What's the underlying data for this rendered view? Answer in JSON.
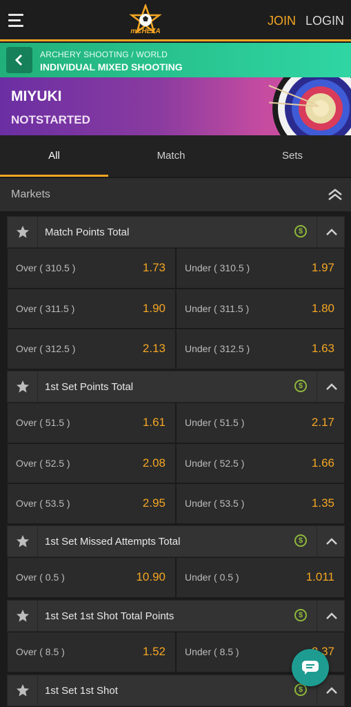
{
  "header": {
    "logo_text": "mCHEZA",
    "join_label": "JOIN",
    "login_label": "LOGIN",
    "accent_color": "#f5a623"
  },
  "breadcrumb": {
    "sport": "ARCHERY SHOOTING / WORLD",
    "event": "INDIVIDUAL MIXED SHOOTING"
  },
  "hero": {
    "name": "MIYUKI",
    "status": "NOTSTARTED"
  },
  "tabs": [
    {
      "label": "All",
      "active": true
    },
    {
      "label": "Match",
      "active": false
    },
    {
      "label": "Sets",
      "active": false
    }
  ],
  "markets_section": {
    "title": "Markets"
  },
  "markets": [
    {
      "name": "Match Points Total",
      "rows": [
        {
          "over_label": "Over ( 310.5 )",
          "over_odd": "1.73",
          "under_label": "Under ( 310.5 )",
          "under_odd": "1.97"
        },
        {
          "over_label": "Over ( 311.5 )",
          "over_odd": "1.90",
          "under_label": "Under ( 311.5 )",
          "under_odd": "1.80"
        },
        {
          "over_label": "Over ( 312.5 )",
          "over_odd": "2.13",
          "under_label": "Under ( 312.5 )",
          "under_odd": "1.63"
        }
      ]
    },
    {
      "name": "1st Set Points Total",
      "rows": [
        {
          "over_label": "Over ( 51.5 )",
          "over_odd": "1.61",
          "under_label": "Under ( 51.5 )",
          "under_odd": "2.17"
        },
        {
          "over_label": "Over ( 52.5 )",
          "over_odd": "2.08",
          "under_label": "Under ( 52.5 )",
          "under_odd": "1.66"
        },
        {
          "over_label": "Over ( 53.5 )",
          "over_odd": "2.95",
          "under_label": "Under ( 53.5 )",
          "under_odd": "1.35"
        }
      ]
    },
    {
      "name": "1st Set Missed Attempts Total",
      "rows": [
        {
          "over_label": "Over ( 0.5 )",
          "over_odd": "10.90",
          "under_label": "Under ( 0.5 )",
          "under_odd": "1.011"
        }
      ]
    },
    {
      "name": "1st Set 1st Shot Total Points",
      "rows": [
        {
          "over_label": "Over ( 8.5 )",
          "over_odd": "1.52",
          "under_label": "Under ( 8.5 )",
          "under_odd": "2.37"
        }
      ]
    },
    {
      "name": "1st Set 1st Shot",
      "rows": []
    }
  ],
  "icons": {
    "menu": "hamburger-icon",
    "back": "chevron-left-icon",
    "collapse_all": "double-chevron-up-icon",
    "favorite": "star-icon",
    "cashout": "dollar-circle-icon",
    "collapse": "chevron-up-icon",
    "chat": "chat-bubble-icon"
  }
}
